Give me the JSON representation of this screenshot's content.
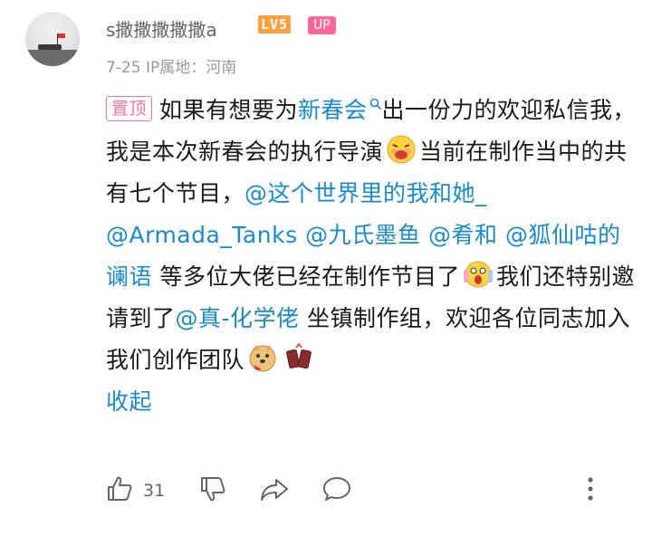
{
  "user": {
    "name": "s撒撒撒撒撒a",
    "level_badge": "LV5",
    "up_badge": "UP"
  },
  "meta": {
    "date": "7-25",
    "ip_location": "IP属地：河南"
  },
  "comment": {
    "pinned_label": "置顶",
    "t1": "如果有想要为",
    "link1": "新春会",
    "t2": "出一份力的欢迎私信我，我是本次新春会的执行导演",
    "t3": "当前在制作当中的共有七个节目，",
    "mention1": "@这个世界里的我和她_",
    "mention2": "@Armada_Tanks",
    "mention3": "@九氏墨鱼",
    "mention4": "@肴和",
    "mention5": "@狐仙咕的谰语",
    "t4": "等多位大佬已经在制作节目了",
    "t5": "我们还特别邀请到了",
    "mention6": "@真-化学佬",
    "t6": "坐镇制作组，欢迎各位同志加入我们创作团队",
    "collapse": "收起"
  },
  "actions": {
    "like_count": "31"
  },
  "icons": [
    "thumbs-up-icon",
    "thumbs-down-icon",
    "share-icon",
    "comment-icon",
    "more-icon",
    "search-icon"
  ],
  "colors": {
    "link": "#178bcf",
    "pink": "#fb7299",
    "level": "#ff9f3e",
    "up": "#ff6699"
  }
}
